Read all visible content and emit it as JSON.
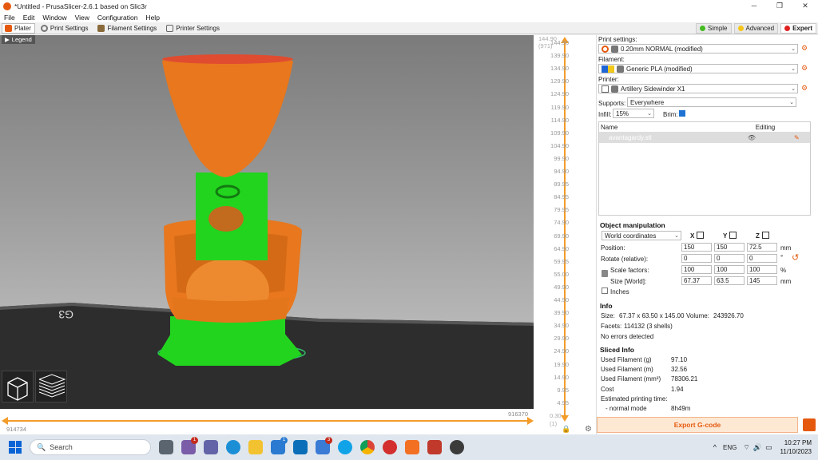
{
  "window": {
    "title": "*Untitled - PrusaSlicer-2.6.1 based on Slic3r",
    "controls": [
      "─",
      "❐",
      "✕"
    ]
  },
  "menu": [
    "File",
    "Edit",
    "Window",
    "View",
    "Configuration",
    "Help"
  ],
  "tabs": [
    {
      "label": "Plater",
      "icon": "plater-icon",
      "active": true
    },
    {
      "label": "Print Settings",
      "icon": "gear-icon",
      "active": false
    },
    {
      "label": "Filament Settings",
      "icon": "filament-icon",
      "active": false
    },
    {
      "label": "Printer Settings",
      "icon": "printer-icon",
      "active": false
    }
  ],
  "modes": [
    {
      "label": "Simple",
      "color": "#44bb22",
      "active": false
    },
    {
      "label": "Advanced",
      "color": "#f5c518",
      "active": false
    },
    {
      "label": "Expert",
      "color": "#e02020",
      "active": true
    }
  ],
  "viewport": {
    "legend_label": "Legend"
  },
  "vertical_slider": {
    "top_value": "144.90",
    "top_layer": "(971)",
    "bottom_value": "0.30",
    "bottom_layer": "(1)",
    "ticks": [
      "144.90",
      "139.90",
      "134.90",
      "129.90",
      "124.90",
      "119.90",
      "114.90",
      "109.90",
      "104.90",
      "99.90",
      "94.90",
      "89.95",
      "84.95",
      "79.95",
      "74.90",
      "69.90",
      "64.90",
      "59.95",
      "55.00",
      "49.90",
      "44.90",
      "39.90",
      "34.90",
      "29.90",
      "24.90",
      "19.90",
      "14.90",
      "9.95",
      "4.95",
      "0.30"
    ]
  },
  "horizontal_slider": {
    "left_value": "914734",
    "right_value": "916370"
  },
  "sidebar": {
    "print_settings_label": "Print settings:",
    "print_settings_value": "0.20mm NORMAL (modified)",
    "filament_label": "Filament:",
    "filament_value": "Generic PLA (modified)",
    "printer_label": "Printer:",
    "printer_value": "Artillery Sidewinder X1",
    "supports_label": "Supports:",
    "supports_value": "Everywhere",
    "infill_label": "Infill:",
    "infill_value": "15%",
    "brim_label": "Brim:",
    "list_headers": [
      "Name",
      "Editing"
    ],
    "object_name": "avantagardy.stl"
  },
  "object_manipulation": {
    "title": "Object manipulation",
    "coord_system": "World coordinates",
    "axes": [
      "X",
      "Y",
      "Z"
    ],
    "position_label": "Position:",
    "position": [
      "150",
      "150",
      "72.5"
    ],
    "position_unit": "mm",
    "rotate_label": "Rotate (relative):",
    "rotate": [
      "0",
      "0",
      "0"
    ],
    "rotate_unit": "°",
    "scale_label": "Scale factors:",
    "scale": [
      "100",
      "100",
      "100"
    ],
    "scale_unit": "%",
    "size_label": "Size [World]:",
    "size": [
      "67.37",
      "63.5",
      "145"
    ],
    "size_unit": "mm",
    "inches_label": "Inches"
  },
  "info": {
    "title": "Info",
    "size_label": "Size:",
    "size_value": "67.37 x 63.50 x 145.00",
    "volume_label": "Volume:",
    "volume_value": "243926.70",
    "facets_label": "Facets:",
    "facets_value": "114132 (3 shells)",
    "errors": "No errors detected"
  },
  "sliced_info": {
    "title": "Sliced Info",
    "rows": [
      {
        "label": "Used Filament (g)",
        "value": "97.10"
      },
      {
        "label": "Used Filament (m)",
        "value": "32.56"
      },
      {
        "label": "Used Filament (mm³)",
        "value": "78306.21"
      },
      {
        "label": "Cost",
        "value": "1.94"
      }
    ],
    "time_label": "Estimated printing time:",
    "mode_label": "- normal mode",
    "mode_value": "8h49m"
  },
  "export_button": "Export G-code",
  "taskbar": {
    "search_placeholder": "Search",
    "language": "ENG",
    "time": "10:27 PM",
    "date": "11/10/2023",
    "badges": [
      "1",
      "1",
      "3"
    ]
  }
}
